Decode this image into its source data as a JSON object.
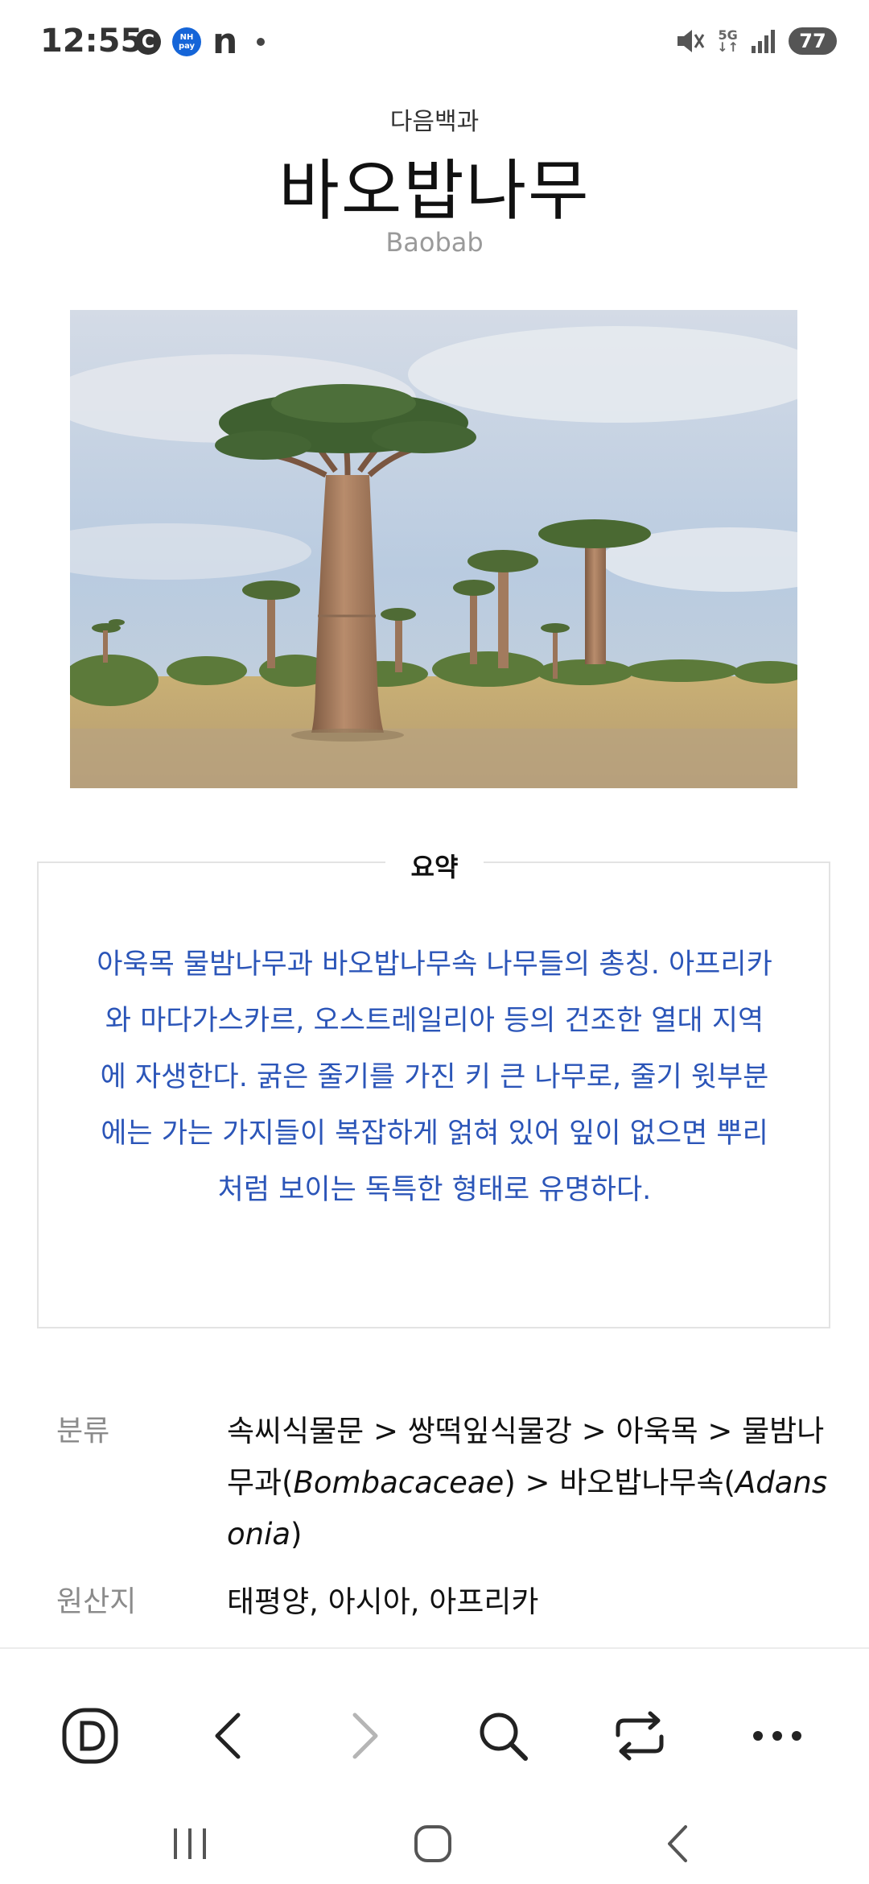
{
  "status_bar": {
    "time": "12:55",
    "icons": [
      "c-app-icon",
      "nh-pay-icon",
      "n-app-icon",
      "notification-dot",
      "mute-icon",
      "5g-icon",
      "signal-icon",
      "battery-icon"
    ],
    "nh_label": "NH pay",
    "network": "5G",
    "battery": "77"
  },
  "article": {
    "source": "다음백과",
    "title": "바오밥나무",
    "subtitle": "Baobab"
  },
  "summary": {
    "label": "요약",
    "text": "아욱목 물밤나무과 바오밥나무속 나무들의 총칭. 아프리카와 마다가스카르, 오스트레일리아 등의 건조한 열대 지역에 자생한다. 굵은 줄기를 가진 키 큰 나무로, 줄기 윗부분에는 가는 가지들이 복잡하게 얽혀 있어 잎이 없으면 뿌리처럼 보이는 독특한 형태로 유명하다."
  },
  "info": {
    "classification_label": "분류",
    "classification_part1": "속씨식물문 > 쌍떡잎식물강 > 아욱목 > 물밤나무과(",
    "classification_family": "Bombacaceae",
    "classification_part2": ") > 바오밥나무속(",
    "classification_genus": "Adansonia",
    "classification_part3": ")",
    "origin_label": "원산지",
    "origin_value": "태평양, 아시아, 아프리카"
  },
  "browser_bar": {
    "buttons": [
      "daum-home-icon",
      "back-icon",
      "forward-icon",
      "search-icon",
      "tabs-switch-icon",
      "more-icon"
    ],
    "forward_enabled": false
  },
  "system_nav": {
    "buttons": [
      "recent-apps-icon",
      "home-icon",
      "system-back-icon"
    ]
  },
  "colors": {
    "summary_text": "#2b55b8",
    "label_gray": "#8b8b8b",
    "nh_blue": "#1565d8"
  }
}
